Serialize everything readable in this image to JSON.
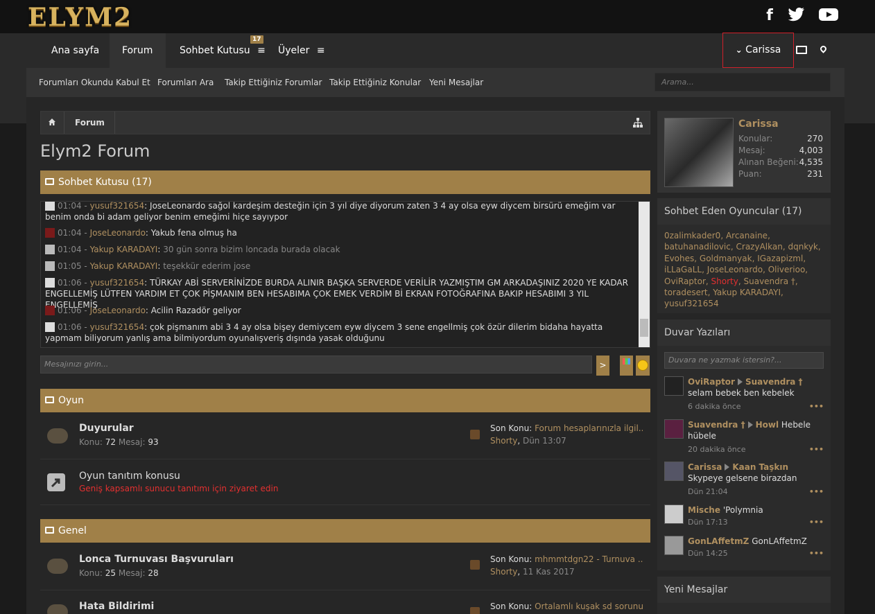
{
  "logo": "ELYM2",
  "nav": {
    "home": "Ana sayfa",
    "forum": "Forum",
    "chat": "Sohbet Kutusu",
    "chat_badge": "17",
    "members": "Üyeler",
    "user": "Carissa"
  },
  "subnav": [
    "Forumları Okundu Kabul Et",
    "Forumları Ara",
    "Takip Ettiğiniz Forumlar",
    "Takip Ettiğiniz Konular",
    "Yeni Mesajlar"
  ],
  "search_placeholder": "Arama...",
  "breadcrumb": {
    "forum": "Forum"
  },
  "page_title": "Elym2 Forum",
  "chat": {
    "title": "Sohbet Kutusu (17)",
    "lines": [
      {
        "time": "01:04",
        "user": "yusuf321654",
        "msg": "JoseLeonardo sağol kardeşim desteğin için 3 yıl diye diyorum zaten 3 4 ay olsa eyw diycem birsürü emeğim var benim onda bi adam geliyor benim emeğimi hiçe sayıypor"
      },
      {
        "time": "01:04",
        "user": "JoseLeonardo",
        "msg": "Yakub fena olmuş ha"
      },
      {
        "time": "01:04",
        "user": "Yakup KARADAYI",
        "msg": "30 gün sonra bizim loncada burada olacak"
      },
      {
        "time": "01:05",
        "user": "Yakup KARADAYI",
        "msg": "teşekkür ederim jose"
      },
      {
        "time": "01:06",
        "user": "yusuf321654",
        "msg": "TÜRKAY ABİ SERVERİNİZDE BURDA ALINIR BAŞKA SERVERDE VERİLİR YAZMIŞTIM GM ARKADAŞINIZ 2020 YE KADAR ENGELLEMİŞ LÜTFEN YARDIM ET ÇOK PİŞMANIM BEN HESABIMA ÇOK EMEK VERDİM Bİ EKRAN FOTOĞRAFINA BAKIP HESABIMI 3 YIL ENGELLEMİŞ"
      },
      {
        "time": "01:06",
        "user": "JoseLeonardo",
        "msg": "Acilin Razadör geliyor"
      },
      {
        "time": "01:06",
        "user": "yusuf321654",
        "msg": "çok pişmanım abi 3 4 ay olsa bişey demiycem eyw diycem 3 sene engellmiş çok özür dilerim bidaha hayatta yapmam biliyorum yanlış ama bilmiyordum oyunalışveriş dışında yasak olduğunu"
      }
    ],
    "input_placeholder": "Mesajınızı girin...",
    "send": ">"
  },
  "categories": {
    "oyun": "Oyun",
    "genel": "Genel"
  },
  "forums": {
    "duyurular": {
      "title": "Duyurular",
      "konu_label": "Konu:",
      "konu": "72",
      "mesaj_label": "Mesaj:",
      "mesaj": "93",
      "last_label": "Son Konu:",
      "last_title": "Forum hesaplarınızla ilgil...",
      "last_user": "Shorty",
      "last_time": "Dün 13:07"
    },
    "tanitim": {
      "title": "Oyun tanıtım konusu",
      "desc": "Geniş kapsamlı sunucu tanıtımı için ziyaret edin"
    },
    "lonca": {
      "title": "Lonca Turnuvası Başvuruları",
      "konu_label": "Konu:",
      "konu": "25",
      "mesaj_label": "Mesaj:",
      "mesaj": "28",
      "last_label": "Son Konu:",
      "last_title": "mhmmtdgn22 - Turnuva ...",
      "last_user": "Shorty",
      "last_time": "11 Kas 2017"
    },
    "hata": {
      "title": "Hata Bildirimi",
      "last_label": "Son Konu:",
      "last_title": "Ortalamlı kuşak sd sorunu"
    }
  },
  "profile": {
    "name": "Carissa",
    "konular_label": "Konular:",
    "konular": "270",
    "mesaj_label": "Mesaj:",
    "mesaj": "4,003",
    "begeni_label": "Alınan Beğeni:",
    "begeni": "4,535",
    "puan_label": "Puan:",
    "puan": "231"
  },
  "online": {
    "title": "Sohbet Eden Oyuncular (17)",
    "users": [
      "0zalimkader0",
      "Arcanaine",
      "batuhanadilovic",
      "CrazyAlkan",
      "dqnkyk",
      "Evohes",
      "Goldmanyak",
      "IGazapizml",
      "iLLaGaLL",
      "JoseLeonardo",
      "Oliverioo",
      "OviRaptor",
      "Shorty",
      "Suavendra †",
      "toradesert",
      "Yakup KARADAYI",
      "yusuf321654"
    ]
  },
  "wall": {
    "title": "Duvar Yazıları",
    "placeholder": "Duvara ne yazmak istersin?...",
    "items": [
      {
        "from": "OviRaptor",
        "to": "Suavendra †",
        "msg": "selam bebek ben kebelek",
        "time": "6 dakika önce"
      },
      {
        "from": "Suavendra †",
        "to": "Howl",
        "msg": "Hebele hübele",
        "time": "20 dakika önce"
      },
      {
        "from": "Carissa",
        "to": "Kaan Taşkın",
        "msg": "Skypeye gelsene birazdan",
        "time": "Dün 21:04"
      },
      {
        "from": "Mische",
        "msg": "'Polymnia",
        "time": "Dün 17:13"
      },
      {
        "from": "GonLAffetmZ",
        "msg": "GonLAffetmZ",
        "time": "Dün 14:25"
      }
    ],
    "more": "•••"
  },
  "new_messages": {
    "title": "Yeni Mesajlar"
  },
  "colors": {
    "accent": "#a08048",
    "gold_text": "#b09060",
    "highlight": "#e43030"
  }
}
